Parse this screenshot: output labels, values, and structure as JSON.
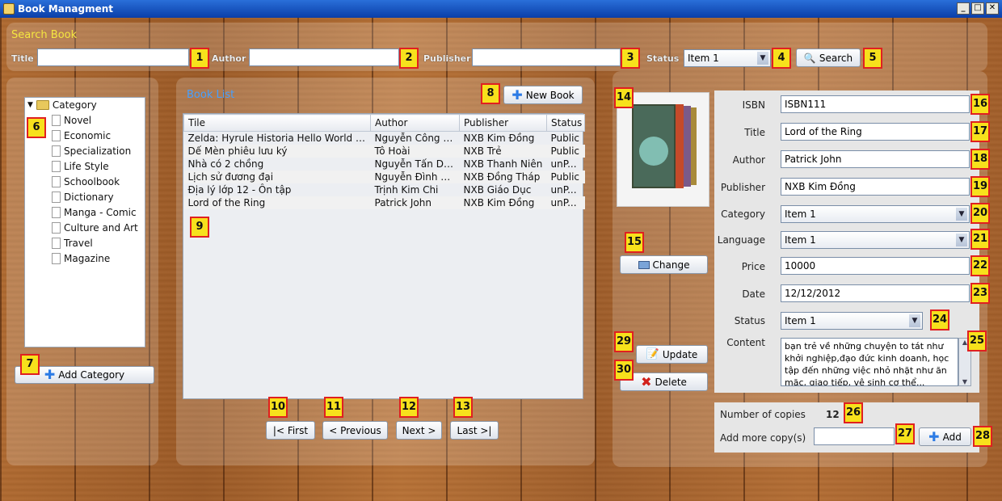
{
  "window": {
    "title": "Book Managment",
    "controls": [
      "_",
      "□",
      "✕"
    ]
  },
  "search": {
    "title": "Search Book",
    "title_label": "Title",
    "author_label": "Author",
    "publisher_label": "Publisher",
    "status_label": "Status",
    "title_value": "",
    "author_value": "",
    "publisher_value": "",
    "status_value": "Item 1",
    "search_button": "Search"
  },
  "categories": {
    "root": "Category",
    "items": [
      "Novel",
      "Economic",
      "Specialization",
      "Life Style",
      "Schoolbook",
      "Dictionary",
      "Manga - Comic",
      "Culture and Art",
      "Travel",
      "Magazine"
    ],
    "add_button": "Add Category"
  },
  "booklist": {
    "title": "Book List",
    "new_button": "New Book",
    "columns": [
      "Tile",
      "Author",
      "Publisher",
      "Status"
    ],
    "rows": [
      [
        "Zelda: Hyrule Historia Hello World RD...",
        "Nguyễn Công H...",
        "NXB Kim Đồng",
        "Public"
      ],
      [
        "Dế Mèn phiêu lưu ký",
        "Tô Hoài",
        "NXB Trẻ",
        "Public"
      ],
      [
        "Nhà có 2 chồng",
        "Nguyễn Tấn Dũng",
        "NXB Thanh Niên",
        "unP..."
      ],
      [
        "Lịch sử đương đại",
        "Nguyễn Đình Ch...",
        "NXB Đồng Tháp",
        "Public"
      ],
      [
        "Địa lý lớp 12 - Ôn tập",
        "Trịnh Kim Chi",
        "NXB Giáo Dục",
        "unP..."
      ],
      [
        "Lord of the Ring",
        "Patrick John",
        "NXB Kim Đồng",
        "unP..."
      ]
    ],
    "first": "|< First",
    "previous": "< Previous",
    "next": "Next >",
    "last": "Last >|"
  },
  "detail": {
    "change_button": "Change",
    "update_button": "Update",
    "delete_button": "Delete",
    "isbn_label": "ISBN",
    "isbn": "ISBN111",
    "title_label": "Title",
    "title": "Lord of the Ring",
    "author_label": "Author",
    "author": "Patrick John",
    "publisher_label": "Publisher",
    "publisher": "NXB Kim Đồng",
    "category_label": "Category",
    "category": "Item 1",
    "language_label": "Language",
    "language": "Item 1",
    "price_label": "Price",
    "price": "10000",
    "date_label": "Date",
    "date": "12/12/2012",
    "status_label": "Status",
    "status": "Item 1",
    "content_label": "Content",
    "content": "bạn trẻ về những chuyện to tát như khởi nghiệp,đạo đức kinh doanh, học tập đến những việc nhỏ nhặt như ăn mặc, giao tiếp, vệ sinh cơ thể...",
    "copies_label": "Number of copies",
    "copies": "12",
    "add_copies_label": "Add more copy(s)",
    "add_copies_value": "",
    "add_button": "Add"
  },
  "badges": [
    "1",
    "2",
    "3",
    "4",
    "5",
    "6",
    "7",
    "8",
    "9",
    "10",
    "11",
    "12",
    "13",
    "14",
    "15",
    "16",
    "17",
    "18",
    "19",
    "20",
    "21",
    "22",
    "23",
    "24",
    "25",
    "26",
    "27",
    "28",
    "29",
    "30"
  ],
  "colors": {
    "titlebar": "#0a3ea8",
    "section_title": "#f4e640",
    "booklist_title": "#46a0ff",
    "badge_fill": "#f7e11c",
    "badge_border": "#e02020"
  }
}
